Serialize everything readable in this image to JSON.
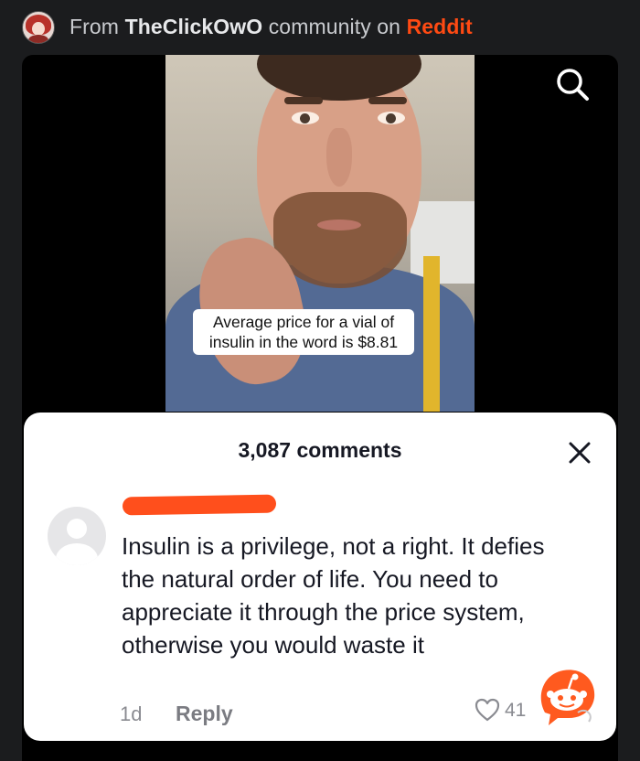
{
  "header": {
    "prefix": "From",
    "community": "TheClickOwO",
    "middle": "community on",
    "site": "Reddit"
  },
  "video": {
    "caption": "Average price for a vial of insulin in the word is $8.81"
  },
  "comments": {
    "count_label": "3,087 comments",
    "items": [
      {
        "text": "Insulin is a privilege, not a right. It defies the natural order of life. You need to appreciate it through the price system, otherwise you would waste it",
        "time": "1d",
        "reply_label": "Reply",
        "likes": "41"
      }
    ]
  },
  "colors": {
    "reddit_orange": "#ff4500",
    "redaction": "#ff4f1c",
    "background": "#1b1c1e"
  },
  "icons": [
    "subreddit-avatar",
    "search-icon",
    "close-icon",
    "user-avatar",
    "heart-icon",
    "snoo-logo"
  ]
}
